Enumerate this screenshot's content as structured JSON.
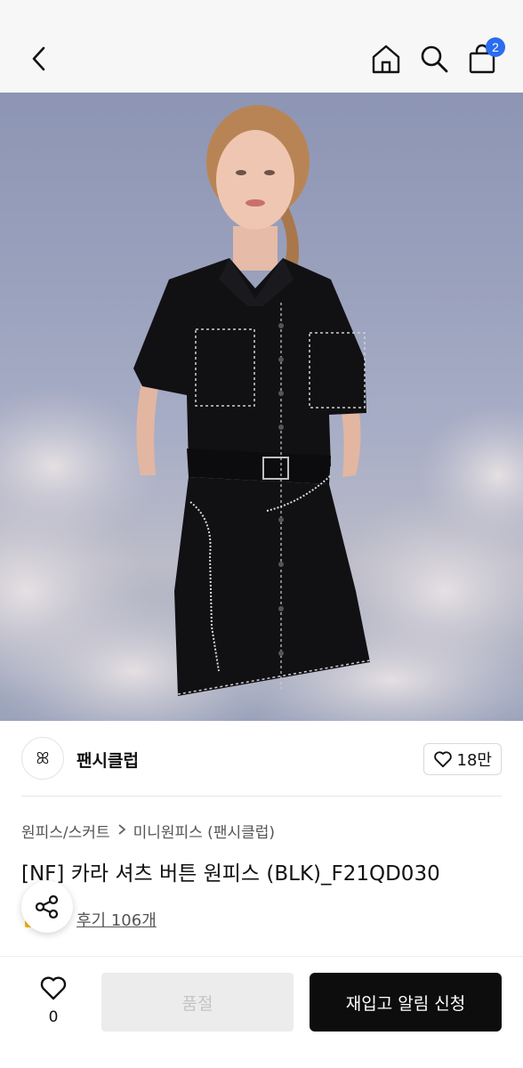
{
  "header": {
    "cart_count": "2",
    "icons": [
      "back-arrow-icon",
      "home-icon",
      "search-icon",
      "cart-icon"
    ]
  },
  "brand": {
    "name": "팬시클럽",
    "logo_text": "ꕤ",
    "likes": "18만"
  },
  "product": {
    "breadcrumb": [
      "원피스/스커트",
      "미니원피스 (팬시클럽)"
    ],
    "title": "[NF] 카라 셔츠 버튼 원피스 (BLK)_F21QD030",
    "review_text": "후기 106개"
  },
  "footer": {
    "wish_count": "0",
    "soldout_label": "품절",
    "restock_label": "재입고 알림 신청"
  },
  "colors": {
    "accent_badge": "#2b6cf0",
    "cta_bg": "#0d0d0d",
    "disabled_bg": "#ececec"
  }
}
